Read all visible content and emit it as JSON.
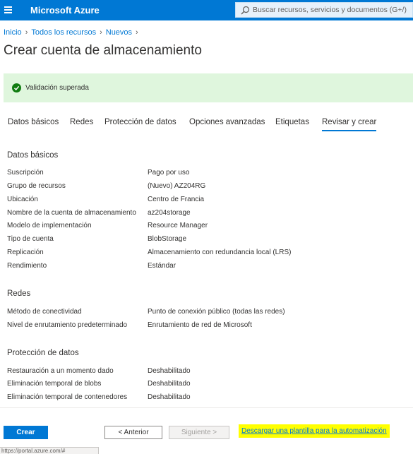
{
  "topbar": {
    "brand": "Microsoft Azure",
    "search_placeholder": "Buscar recursos, servicios y documentos (G+/)",
    "bg_color": "#0078d4"
  },
  "breadcrumb": [
    "Inicio",
    "Todos los recursos",
    "Nuevos"
  ],
  "page_title": "Crear cuenta de almacenamiento",
  "validation": {
    "text": "Validación superada",
    "color": "#107c10"
  },
  "tabs": [
    {
      "label": "Datos básicos"
    },
    {
      "label": "Redes"
    },
    {
      "label": "Protección de datos"
    },
    {
      "label": "Opciones avanzadas"
    },
    {
      "label": "Etiquetas"
    },
    {
      "label": "Revisar y crear",
      "active": true
    }
  ],
  "sections": {
    "basics": {
      "heading": "Datos básicos",
      "rows": [
        {
          "label": "Suscripción",
          "value": "Pago por uso"
        },
        {
          "label": "Grupo de recursos",
          "value": "(Nuevo) AZ204RG"
        },
        {
          "label": "Ubicación",
          "value": "Centro de Francia"
        },
        {
          "label": "Nombre de la cuenta de almacenamiento",
          "value": "az204storage"
        },
        {
          "label": "Modelo de implementación",
          "value": "Resource Manager"
        },
        {
          "label": "Tipo de cuenta",
          "value": "BlobStorage"
        },
        {
          "label": "Replicación",
          "value": "Almacenamiento con redundancia local (LRS)"
        },
        {
          "label": "Rendimiento",
          "value": "Estándar"
        }
      ]
    },
    "networking": {
      "heading": "Redes",
      "rows": [
        {
          "label": "Método de conectividad",
          "value": "Punto de conexión público (todas las redes)"
        },
        {
          "label": "Nivel de enrutamiento predeterminado",
          "value": "Enrutamiento de red de Microsoft"
        }
      ]
    },
    "data_protection": {
      "heading": "Protección de datos",
      "rows": [
        {
          "label": "Restauración a un momento dado",
          "value": "Deshabilitado"
        },
        {
          "label": "Eliminación temporal de blobs",
          "value": "Deshabilitado"
        },
        {
          "label": "Eliminación temporal de contenedores",
          "value": "Deshabilitado"
        }
      ]
    }
  },
  "footer": {
    "create_label": "Crear",
    "prev_label": "< Anterior",
    "next_label": "Siguiente >",
    "download_link": "Descargar una plantilla para la automatización"
  },
  "statusbar_text": "https://portal.azure.com/#"
}
